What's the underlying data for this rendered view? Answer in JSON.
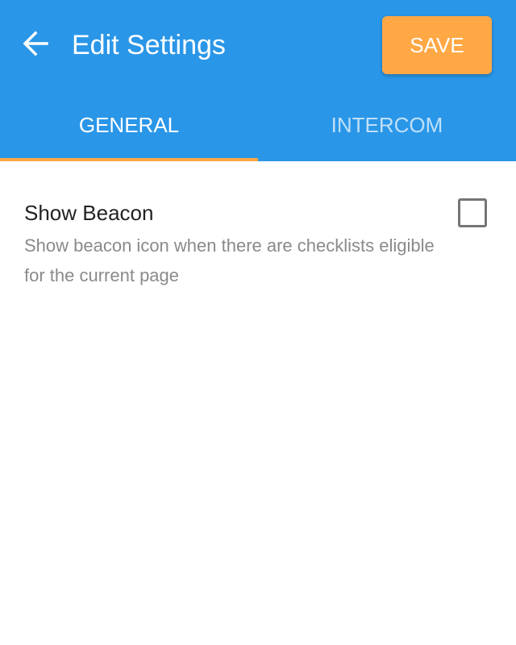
{
  "header": {
    "title": "Edit Settings",
    "save_label": "SAVE",
    "back_icon": "arrow-left-icon",
    "colors": {
      "app_bar": "#2a96e8",
      "accent": "#ffa845"
    }
  },
  "tabs": [
    {
      "label": "GENERAL",
      "active": true
    },
    {
      "label": "INTERCOM",
      "active": false
    }
  ],
  "settings": [
    {
      "title": "Show Beacon",
      "description": "Show beacon icon when there are checklists eligible for the current page",
      "checked": false
    }
  ]
}
